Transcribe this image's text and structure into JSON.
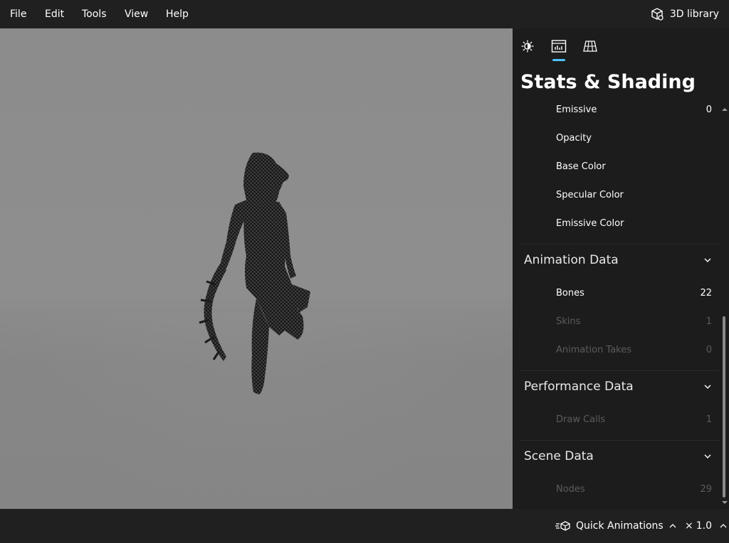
{
  "menu": {
    "file": "File",
    "edit": "Edit",
    "tools": "Tools",
    "view": "View",
    "help": "Help",
    "library_label": "3D library",
    "library_icon": "cube-box-icon"
  },
  "panel": {
    "tabs": [
      {
        "icon": "sun-icon",
        "selected": false
      },
      {
        "icon": "stats-chart-icon",
        "selected": true
      },
      {
        "icon": "grid-mesh-icon",
        "selected": false
      }
    ],
    "title": "Stats & Shading",
    "shading_rows": [
      {
        "label": "Emissive",
        "value": "0"
      },
      {
        "label": "Opacity",
        "value": ""
      },
      {
        "label": "Base Color",
        "value": ""
      },
      {
        "label": "Specular Color",
        "value": ""
      },
      {
        "label": "Emissive Color",
        "value": ""
      }
    ],
    "animation": {
      "title": "Animation Data",
      "rows": [
        {
          "label": "Bones",
          "value": "22",
          "dim": false
        },
        {
          "label": "Skins",
          "value": "1",
          "dim": true
        },
        {
          "label": "Animation Takes",
          "value": "0",
          "dim": true
        }
      ]
    },
    "performance": {
      "title": "Performance Data",
      "rows": [
        {
          "label": "Draw Calls",
          "value": "1",
          "dim": true
        }
      ]
    },
    "scene": {
      "title": "Scene Data",
      "rows": [
        {
          "label": "Nodes",
          "value": "29",
          "dim": true
        }
      ]
    },
    "accent_color": "#4cc2ff"
  },
  "bottom": {
    "quick_animations": "Quick Animations",
    "speed": "1.0",
    "speed_prefix": "×"
  }
}
